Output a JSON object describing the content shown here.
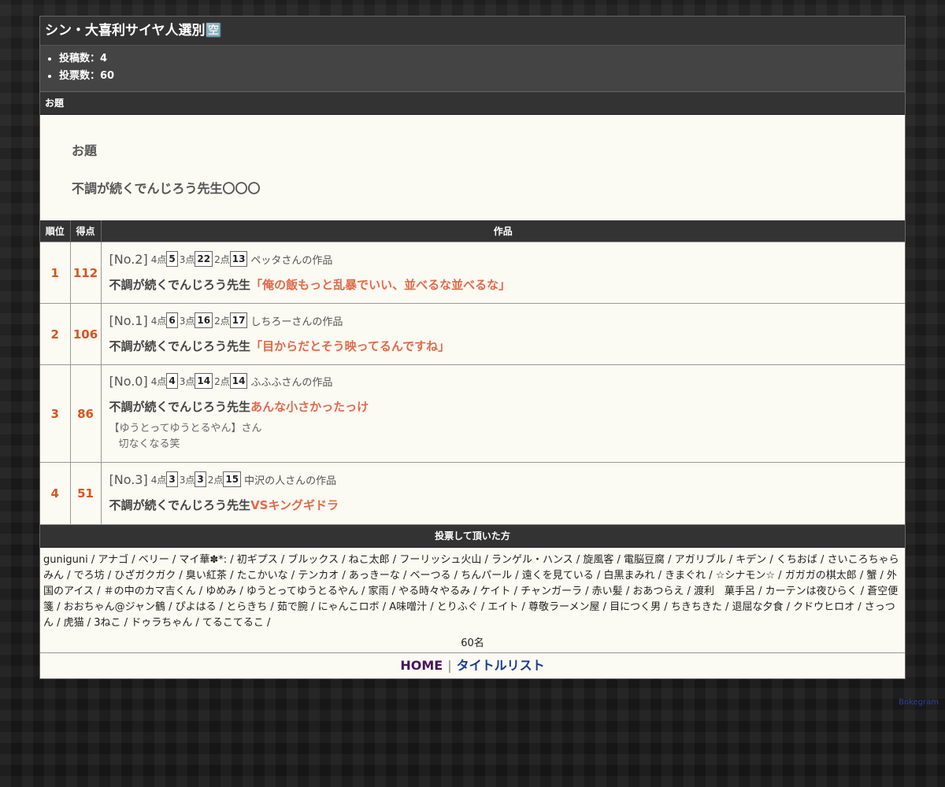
{
  "title": "シン・大喜利サイヤ人選別🈳",
  "stats": [
    "投稿数：4",
    "投票数：60"
  ],
  "odai_section": {
    "header": "お題",
    "label": "お題",
    "text": "不調が続くでんじろう先生〇〇〇"
  },
  "results_table": {
    "headers": {
      "rank": "順位",
      "score": "得点",
      "work": "作品"
    },
    "rows": [
      {
        "rank": "1",
        "score": "112",
        "no": "[No.2]",
        "pt4_label": "4点",
        "pt4": "5",
        "pt3_label": "3点",
        "pt3": "22",
        "pt2_label": "2点",
        "pt2": "13",
        "author": "ペッタさんの作品",
        "prefix": "不調が続くでんじろう先生",
        "answer": "「俺の飯もっと乱暴でいい、並べるな並べるな」",
        "comment_by": "",
        "comment": ""
      },
      {
        "rank": "2",
        "score": "106",
        "no": "[No.1]",
        "pt4_label": "4点",
        "pt4": "6",
        "pt3_label": "3点",
        "pt3": "16",
        "pt2_label": "2点",
        "pt2": "17",
        "author": "しちろーさんの作品",
        "prefix": "不調が続くでんじろう先生",
        "answer": "「目からだとそう映ってるんですね」",
        "comment_by": "",
        "comment": ""
      },
      {
        "rank": "3",
        "score": "86",
        "no": "[No.0]",
        "pt4_label": "4点",
        "pt4": "4",
        "pt3_label": "3点",
        "pt3": "14",
        "pt2_label": "2点",
        "pt2": "14",
        "author": "ふふふさんの作品",
        "prefix": "不調が続くでんじろう先生",
        "answer": "あんな小さかったっけ",
        "comment_by": "【ゆうとってゆうとるやん】さん",
        "comment": "切なくなる笑"
      },
      {
        "rank": "4",
        "score": "51",
        "no": "[No.3]",
        "pt4_label": "4点",
        "pt4": "3",
        "pt3_label": "3点",
        "pt3": "3",
        "pt2_label": "2点",
        "pt2": "15",
        "author": "中沢の人さんの作品",
        "prefix": "不調が続くでんじろう先生",
        "answer": "VSキングギドラ",
        "comment_by": "",
        "comment": ""
      }
    ]
  },
  "voters_section": {
    "header": "投票して頂いた方",
    "voters_text": "guniguni / アナゴ / ベリー / マイ華✽*: / 初ギプス / ブルックス / ねこ太郎 / フーリッシュ火山 / ランゲル・ハンス / 旋風客 / 電脳豆腐 / アガリブル / キデン / くちおば / さいころちゃらみん / でろ坊 / ひざガクガク / 臭い紅茶 / たこかいな / テンカオ / あっきーな / ベーつる / ちんパール / 遠くを見ている / 白黒まみれ / きまぐれ / ☆シナモン☆ / ガガガの棋太郎 / 蟹 / 外国のアイス / ＃の中のカマ吉くん / ゆめみ / ゆうとってゆうとるやん / 家雨 / やる時々やるみ / ケイト / チャンガーラ / 赤い髪 / おあつらえ / 渡利　菓手呂 / カーテンは夜ひらく / 蒼空便箋 / おおちゃん@ジャン鶴 / ぴよはる / とらきち / 茹で腕 / にゃんこロボ / A味噌汁 / とりふぐ / エイト / 尊敬ラーメン屋 / 目につく男 / ちきちきた / 退屈な夕食 / クドウヒロオ / さっつん / 虎猫 / 3ねこ / ドゥラちゃん / てるこてるこ /",
    "count": "60名"
  },
  "nav": {
    "home": "HOME",
    "separator": "|",
    "title_list": "タイトルリスト"
  },
  "credit": "Bokegram",
  "colors": {
    "accent_orange": "#d9541b",
    "answer_orange": "#e06a4a",
    "header_dark": "#333333",
    "panel_bg": "#fbfaf3"
  }
}
